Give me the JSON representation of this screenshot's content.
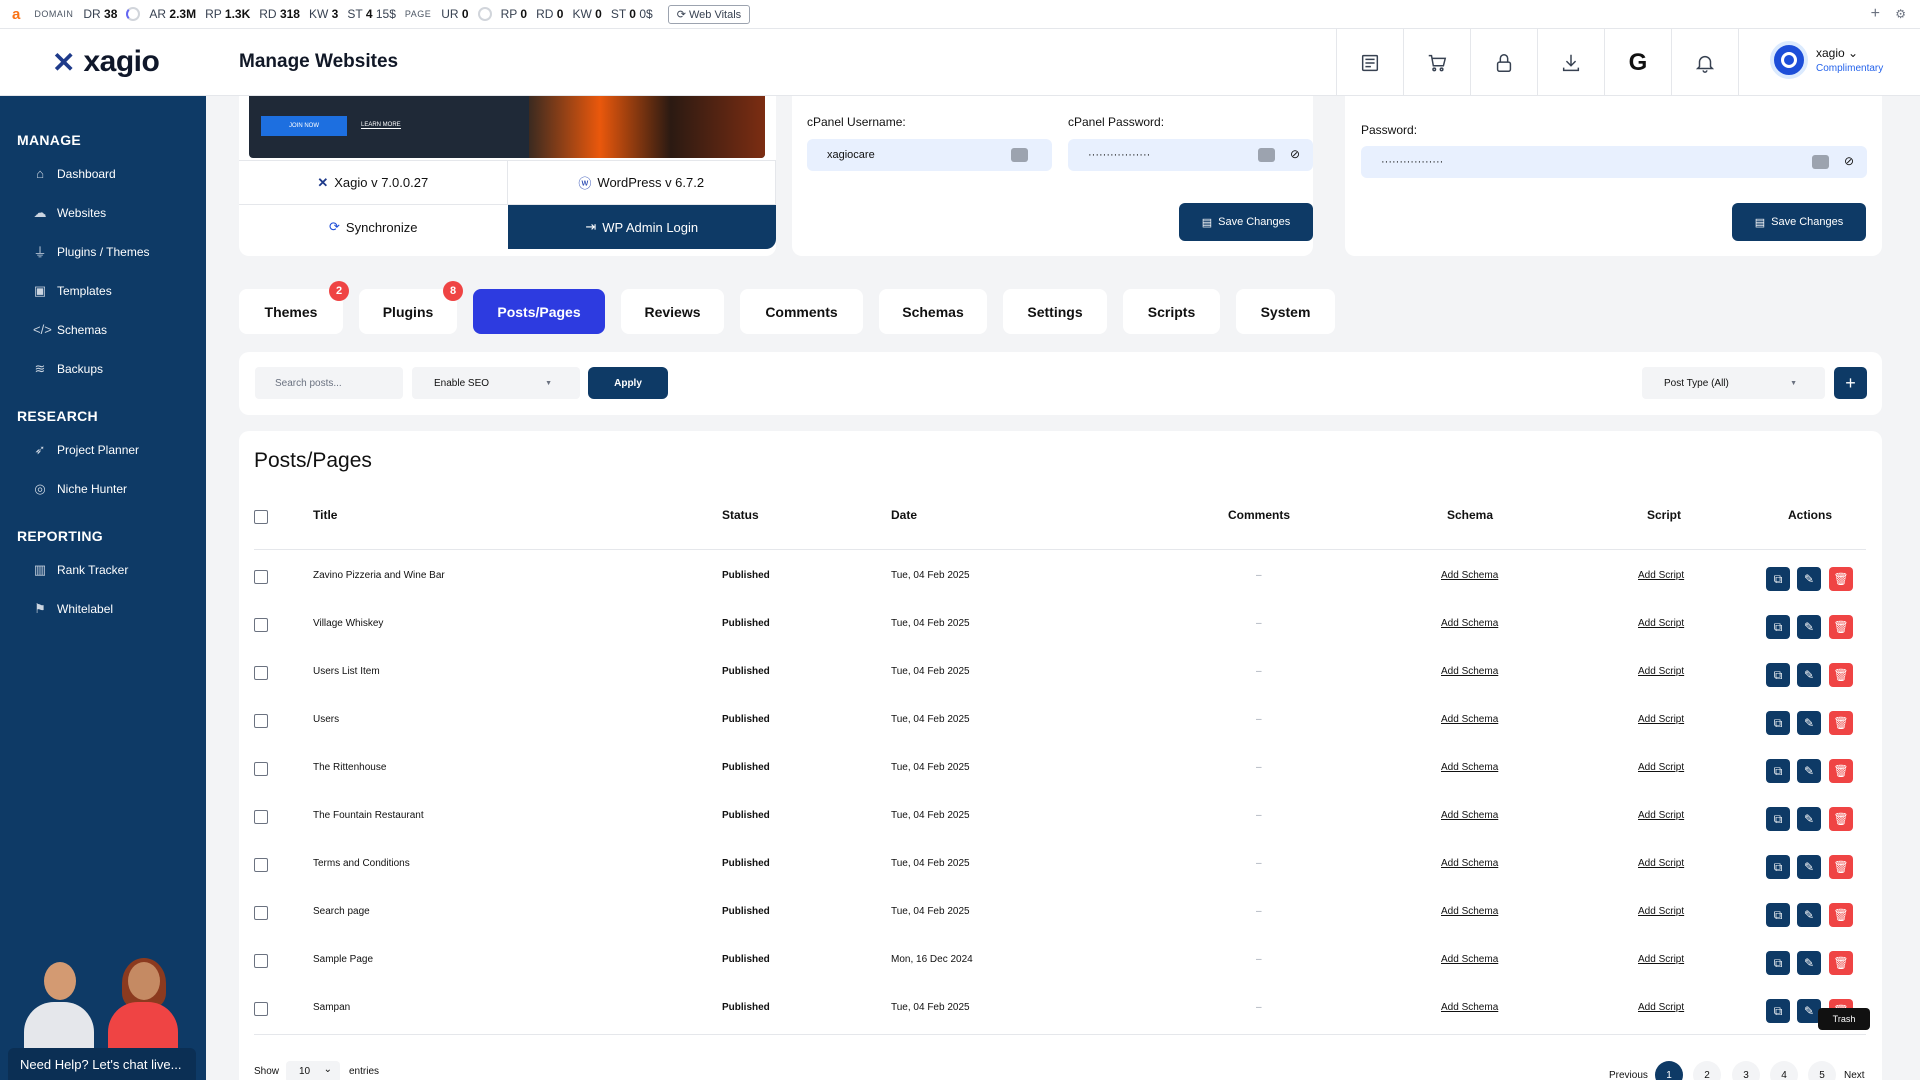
{
  "extbar": {
    "domain_cap": "DOMAIN",
    "dr_label": "DR",
    "dr": "38",
    "ar_label": "AR",
    "ar": "2.3M",
    "rp_label": "RP",
    "rp": "1.3K",
    "rd_label": "RD",
    "rd": "318",
    "kw_label": "KW",
    "kw": "3",
    "st_label": "ST",
    "st": "4",
    "st_val": "15$",
    "page_cap": "PAGE",
    "ur_label": "UR",
    "ur": "0",
    "prp_label": "RP",
    "prp": "0",
    "prd_label": "RD",
    "prd": "0",
    "pkw_label": "KW",
    "pkw": "0",
    "pst_label": "ST",
    "pst": "0",
    "pst_val": "0$",
    "web_vitals": "Web Vitals"
  },
  "header": {
    "logo_text": "xagio",
    "title": "Manage Websites",
    "user_name": "xagio",
    "user_plan": "Complimentary"
  },
  "sidebar": {
    "manage_title": "MANAGE",
    "manage_items": [
      {
        "label": "Dashboard"
      },
      {
        "label": "Websites"
      },
      {
        "label": "Plugins / Themes"
      },
      {
        "label": "Templates"
      },
      {
        "label": "Schemas"
      },
      {
        "label": "Backups"
      }
    ],
    "research_title": "RESEARCH",
    "research_items": [
      {
        "label": "Project Planner"
      },
      {
        "label": "Niche Hunter"
      }
    ],
    "reporting_title": "REPORTING",
    "reporting_items": [
      {
        "label": "Rank Tracker"
      },
      {
        "label": "Whitelabel"
      }
    ],
    "help_text": "Need Help? Let's chat live..."
  },
  "site_card": {
    "preview_join": "JOIN NOW",
    "preview_learn": "LEARN MORE",
    "xagio_version": "Xagio v 7.0.0.27",
    "wp_version": "WordPress v 6.7.2",
    "sync_label": "Synchronize",
    "wp_admin_label": "WP Admin Login"
  },
  "cpanel": {
    "username_label": "cPanel Username:",
    "username_value": "xagiocare",
    "password_label": "cPanel Password:",
    "password_value": "·················",
    "save_label": "Save Changes"
  },
  "wp_creds": {
    "password_label": "Password:",
    "password_value": "·················",
    "save_label": "Save Changes"
  },
  "tabs": [
    {
      "label": "Themes",
      "badge": "2"
    },
    {
      "label": "Plugins",
      "badge": "8"
    },
    {
      "label": "Posts/Pages"
    },
    {
      "label": "Reviews"
    },
    {
      "label": "Comments"
    },
    {
      "label": "Schemas"
    },
    {
      "label": "Settings"
    },
    {
      "label": "Scripts"
    },
    {
      "label": "System"
    }
  ],
  "filter": {
    "search_placeholder": "Search posts...",
    "bulk_action": "Enable SEO",
    "apply_label": "Apply",
    "post_type": "Post Type (All)",
    "add_label": "+"
  },
  "table": {
    "heading": "Posts/Pages",
    "columns": {
      "title": "Title",
      "status": "Status",
      "date": "Date",
      "comments": "Comments",
      "schema": "Schema",
      "script": "Script",
      "actions": "Actions"
    },
    "rows": [
      {
        "title": "Zavino Pizzeria and Wine Bar",
        "status": "Published",
        "date": "Tue, 04 Feb 2025",
        "comments": "–",
        "schema": "Add Schema",
        "script": "Add Script"
      },
      {
        "title": "Village Whiskey",
        "status": "Published",
        "date": "Tue, 04 Feb 2025",
        "comments": "–",
        "schema": "Add Schema",
        "script": "Add Script"
      },
      {
        "title": "Users List Item",
        "status": "Published",
        "date": "Tue, 04 Feb 2025",
        "comments": "–",
        "schema": "Add Schema",
        "script": "Add Script"
      },
      {
        "title": "Users",
        "status": "Published",
        "date": "Tue, 04 Feb 2025",
        "comments": "–",
        "schema": "Add Schema",
        "script": "Add Script"
      },
      {
        "title": "The Rittenhouse",
        "status": "Published",
        "date": "Tue, 04 Feb 2025",
        "comments": "–",
        "schema": "Add Schema",
        "script": "Add Script"
      },
      {
        "title": "The Fountain Restaurant",
        "status": "Published",
        "date": "Tue, 04 Feb 2025",
        "comments": "–",
        "schema": "Add Schema",
        "script": "Add Script"
      },
      {
        "title": "Terms and Conditions",
        "status": "Published",
        "date": "Tue, 04 Feb 2025",
        "comments": "–",
        "schema": "Add Schema",
        "script": "Add Script"
      },
      {
        "title": "Search page",
        "status": "Published",
        "date": "Tue, 04 Feb 2025",
        "comments": "–",
        "schema": "Add Schema",
        "script": "Add Script"
      },
      {
        "title": "Sample Page",
        "status": "Published",
        "date": "Mon, 16 Dec 2024",
        "comments": "–",
        "schema": "Add Schema",
        "script": "Add Script"
      },
      {
        "title": "Sampan",
        "status": "Published",
        "date": "Tue, 04 Feb 2025",
        "comments": "–",
        "schema": "Add Schema",
        "script": "Add Script"
      }
    ],
    "tooltip": "Trash",
    "show_label": "Show",
    "entries_value": "10",
    "entries_label": "entries",
    "pagination": {
      "previous": "Previous",
      "pages": [
        "1",
        "2",
        "3",
        "4",
        "5"
      ],
      "next": "Next",
      "current": "1"
    }
  },
  "colors": {
    "sidebar": "#0e3a66",
    "accent": "#2d3be0",
    "danger": "#ef4444"
  }
}
